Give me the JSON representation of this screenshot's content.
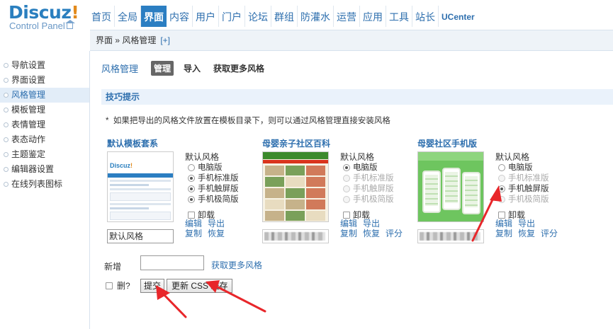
{
  "logo": {
    "brand": "Discuz",
    "brand_mark": "!",
    "subtitle": "Control Panel"
  },
  "topnav": [
    {
      "label": "首页",
      "active": false
    },
    {
      "label": "全局",
      "active": false
    },
    {
      "label": "界面",
      "active": true
    },
    {
      "label": "内容",
      "active": false
    },
    {
      "label": "用户",
      "active": false
    },
    {
      "label": "门户",
      "active": false
    },
    {
      "label": "论坛",
      "active": false
    },
    {
      "label": "群组",
      "active": false
    },
    {
      "label": "防灌水",
      "active": false
    },
    {
      "label": "运营",
      "active": false
    },
    {
      "label": "应用",
      "active": false
    },
    {
      "label": "工具",
      "active": false
    },
    {
      "label": "站长",
      "active": false
    },
    {
      "label": "UCenter",
      "active": false
    }
  ],
  "breadcrumb": {
    "text": "界面 » 风格管理",
    "plus": "[+]"
  },
  "sidebar": {
    "items": [
      {
        "label": "导航设置"
      },
      {
        "label": "界面设置"
      },
      {
        "label": "风格管理"
      },
      {
        "label": "模板管理"
      },
      {
        "label": "表情管理"
      },
      {
        "label": "表态动作"
      },
      {
        "label": "主题鉴定"
      },
      {
        "label": "编辑器设置"
      },
      {
        "label": "在线列表图标"
      }
    ],
    "active_index": 2
  },
  "main": {
    "title": "风格管理",
    "tabs": [
      {
        "label": "管理"
      },
      {
        "label": "导入"
      },
      {
        "label": "获取更多风格"
      }
    ],
    "tips_title": "技巧提示",
    "tip": "如果把导出的风格文件放置在模板目录下，则可以通过风格管理直接安装风格",
    "tip_bullet": "*"
  },
  "styles": [
    {
      "title": "默认模板套系",
      "name_value": "默认风格",
      "options_head": "默认风格",
      "options": [
        {
          "label": "电脑版",
          "checked": false,
          "disabled": false
        },
        {
          "label": "手机标准版",
          "checked": true,
          "disabled": false
        },
        {
          "label": "手机触屏版",
          "checked": true,
          "disabled": false
        },
        {
          "label": "手机极简版",
          "checked": true,
          "disabled": false
        }
      ],
      "uninstall": "卸载",
      "links": [
        "编辑",
        "导出",
        "复制",
        "恢复"
      ],
      "thumb_logo": "Discuz",
      "thumb_logo_mark": "!"
    },
    {
      "title": "母婴亲子社区百科",
      "name_value": "",
      "options_head": "默认风格",
      "options": [
        {
          "label": "电脑版",
          "checked": true,
          "disabled": false
        },
        {
          "label": "手机标准版",
          "checked": false,
          "disabled": true
        },
        {
          "label": "手机触屏版",
          "checked": false,
          "disabled": true
        },
        {
          "label": "手机极简版",
          "checked": false,
          "disabled": true
        }
      ],
      "uninstall": "卸载",
      "links": [
        "编辑",
        "导出",
        "复制",
        "恢复",
        "评分"
      ]
    },
    {
      "title": "母婴社区手机版",
      "name_value": "",
      "options_head": "默认风格",
      "options": [
        {
          "label": "电脑版",
          "checked": false,
          "disabled": false
        },
        {
          "label": "手机标准版",
          "checked": false,
          "disabled": true
        },
        {
          "label": "手机触屏版",
          "checked": true,
          "disabled": false
        },
        {
          "label": "手机极简版",
          "checked": false,
          "disabled": true
        }
      ],
      "uninstall": "卸载",
      "links": [
        "编辑",
        "导出",
        "复制",
        "恢复",
        "评分"
      ]
    }
  ],
  "form": {
    "add_label": "新增",
    "add_value": "",
    "more_link": "获取更多风格",
    "delete_label": "删?",
    "submit_label": "提交",
    "update_css_label": "更新 CSS 缓存"
  },
  "colors": {
    "nav_active": "#2b7ec2",
    "link": "#2e6fae",
    "annotation_arrow": "#e8262a"
  }
}
